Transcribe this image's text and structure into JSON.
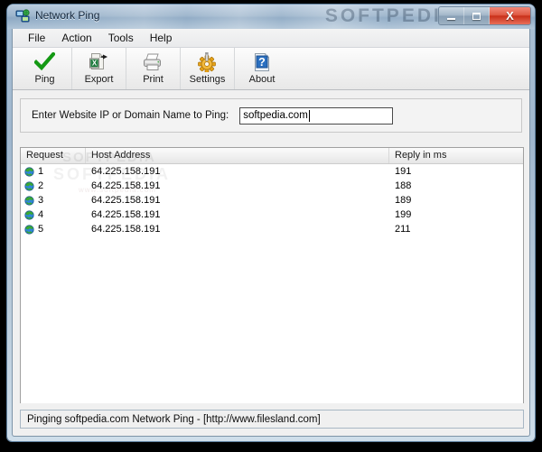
{
  "window": {
    "title": "Network Ping",
    "icon": "network-computers-icon",
    "watermark": "SOFTPEDIA",
    "buttons": {
      "minimize": "Minimize",
      "maximize": "Maximize",
      "close": "Close",
      "close_glyph": "X"
    }
  },
  "menu": {
    "items": [
      {
        "label": "File"
      },
      {
        "label": "Action"
      },
      {
        "label": "Tools"
      },
      {
        "label": "Help"
      }
    ]
  },
  "toolbar": {
    "buttons": [
      {
        "label": "Ping",
        "icon": "green-check-icon"
      },
      {
        "label": "Export",
        "icon": "excel-export-icon"
      },
      {
        "label": "Print",
        "icon": "printer-icon"
      },
      {
        "label": "Settings",
        "icon": "gear-screwdriver-icon"
      },
      {
        "label": "About",
        "icon": "blue-question-page-icon"
      }
    ]
  },
  "input_panel": {
    "label": "Enter Website IP or Domain Name to Ping:",
    "value": "softpedia.com",
    "placeholder": ""
  },
  "list": {
    "columns": [
      "Request",
      "Host Address",
      "Reply in ms"
    ],
    "rows": [
      {
        "request": "1",
        "host": "64.225.158.191",
        "reply": "191",
        "icon": "globe-icon"
      },
      {
        "request": "2",
        "host": "64.225.158.191",
        "reply": "188",
        "icon": "globe-icon"
      },
      {
        "request": "3",
        "host": "64.225.158.191",
        "reply": "189",
        "icon": "globe-icon"
      },
      {
        "request": "4",
        "host": "64.225.158.191",
        "reply": "199",
        "icon": "globe-icon"
      },
      {
        "request": "5",
        "host": "64.225.158.191",
        "reply": "211",
        "icon": "globe-icon"
      }
    ],
    "watermarks": {
      "top": "SOFTPEDIA",
      "mid": "SOFTPEDIA",
      "small": "www.softpedia.com"
    }
  },
  "statusbar": {
    "text": "Pinging softpedia.com Network Ping -  [http://www.filesland.com]"
  },
  "colors": {
    "accent_close": "#c9301a",
    "check_green": "#1c9c1c",
    "gear_orange": "#e8a317",
    "desktop": "#000000"
  }
}
